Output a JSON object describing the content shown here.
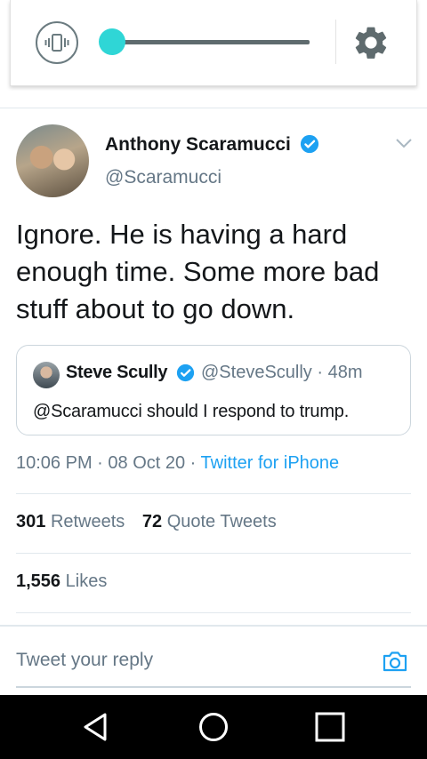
{
  "volume": {
    "level": 0.0,
    "vibrate_icon": "vibrate-icon",
    "settings_icon": "gear-icon",
    "accent_color": "#2fd6d6"
  },
  "tweet": {
    "author_name": "Anthony Scaramucci",
    "author_handle": "@Scaramucci",
    "verified": true,
    "text": "Ignore. He is having a hard enough time. Some more bad stuff about to go down.",
    "time": "10:06 PM",
    "date": "08 Oct 20",
    "source": "Twitter for iPhone",
    "retweets_count": "301",
    "retweets_label": "Retweets",
    "quote_tweets_count": "72",
    "quote_tweets_label": "Quote Tweets",
    "likes_count": "1,556",
    "likes_label": "Likes"
  },
  "quote": {
    "name": "Steve Scully",
    "handle": "@SteveScully",
    "age": "48m",
    "text": "@Scaramucci should I respond to trump."
  },
  "reply": {
    "placeholder": "Tweet your reply"
  },
  "colors": {
    "link": "#1da1f2",
    "muted": "#657786",
    "text": "#14171a"
  },
  "nav": {
    "back_icon": "back-triangle-icon",
    "home_icon": "home-circle-icon",
    "recents_icon": "recents-square-icon"
  }
}
